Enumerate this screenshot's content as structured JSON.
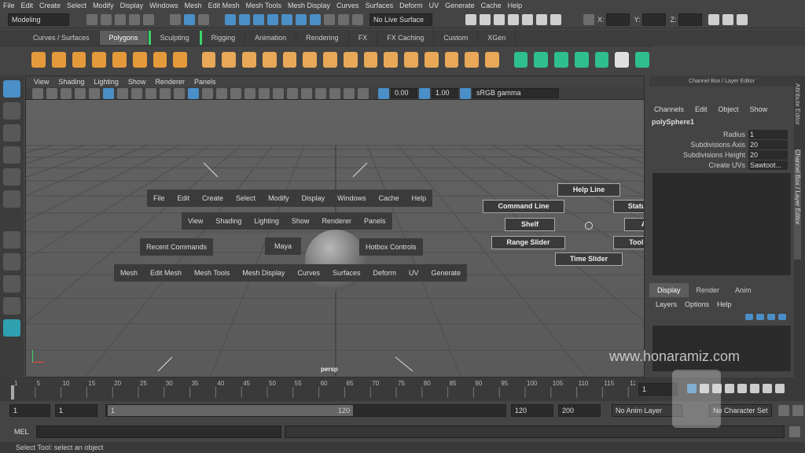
{
  "menubar": [
    "File",
    "Edit",
    "Create",
    "Select",
    "Modify",
    "Display",
    "Windows",
    "Mesh",
    "Edit Mesh",
    "Mesh Tools",
    "Mesh Display",
    "Curves",
    "Surfaces",
    "Deform",
    "UV",
    "Generate",
    "Cache",
    "Help"
  ],
  "status": {
    "mode": "Modeling",
    "live": "No Live Surface",
    "x_label": "X:",
    "y_label": "Y:",
    "z_label": "Z:"
  },
  "shelf_tabs": [
    "Curves / Surfaces",
    "Polygons",
    "Sculpting",
    "Rigging",
    "Animation",
    "Rendering",
    "FX",
    "FX Caching",
    "Custom",
    "XGen"
  ],
  "panel_menu": [
    "View",
    "Shading",
    "Lighting",
    "Show",
    "Renderer",
    "Panels"
  ],
  "panel_tools": {
    "exposure": "0.00",
    "gamma": "1.00",
    "colorspace": "sRGB gamma"
  },
  "camera": "persp",
  "hotbox": {
    "row1": [
      "File",
      "Edit",
      "Create",
      "Select",
      "Modify",
      "Display",
      "Windows",
      "Cache",
      "Help"
    ],
    "row2": [
      "View",
      "Shading",
      "Lighting",
      "Show",
      "Renderer",
      "Panels"
    ],
    "recent": "Recent Commands",
    "maya": "Maya",
    "controls": "Hotbox Controls",
    "row3": [
      "Mesh",
      "Edit Mesh",
      "Mesh Tools",
      "Mesh Display",
      "Curves",
      "Surfaces",
      "Deform",
      "UV",
      "Generate"
    ]
  },
  "radial": {
    "help": "Help Line",
    "command": "Command Line",
    "status": "Status Line",
    "shelf": "Shelf",
    "attributes": "Attributes",
    "range": "Range Slider",
    "toolbox": "Tool Box",
    "time": "Time Slider"
  },
  "channel_box": {
    "title": "Channel Box / Layer Editor",
    "menu": [
      "Channels",
      "Edit",
      "Object",
      "Show"
    ],
    "object": "polySphere1",
    "attrs": [
      {
        "name": "Radius",
        "value": "1"
      },
      {
        "name": "Subdivisions Axis",
        "value": "20"
      },
      {
        "name": "Subdivisions Height",
        "value": "20"
      },
      {
        "name": "Create UVs",
        "value": "Sawtoot..."
      }
    ]
  },
  "layer": {
    "tabs": [
      "Display",
      "Render",
      "Anim"
    ],
    "menu": [
      "Layers",
      "Options",
      "Help"
    ]
  },
  "side_tabs": [
    "Attribute Editor",
    "Channel Box / Layer Editor"
  ],
  "timeline": {
    "ticks": [
      "1",
      "5",
      "10",
      "15",
      "20",
      "25",
      "30",
      "35",
      "40",
      "45",
      "50",
      "55",
      "60",
      "65",
      "70",
      "75",
      "80",
      "85",
      "90",
      "95",
      "100",
      "105",
      "110",
      "115",
      "12"
    ],
    "current": "1"
  },
  "range": {
    "start": "1",
    "startb": "1",
    "slider_start": "1",
    "slider_end": "120",
    "end": "120",
    "endb": "200",
    "anim_layer": "No Anim Layer",
    "char_set": "No Character Set"
  },
  "cmd": {
    "label": "MEL"
  },
  "help_line": "Select Tool: select an object",
  "watermark": {
    "url": "www.honaramiz.com"
  },
  "colors": {
    "accent": "#4a8fc7",
    "green": "#3bd46a"
  }
}
